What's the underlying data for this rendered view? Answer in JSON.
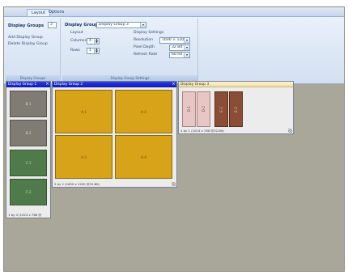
{
  "ribbon_tabs": [
    "Layout",
    "Options"
  ],
  "display_groups": {
    "label": "Display Groups",
    "count": "3",
    "add_label": "Add Display Group",
    "delete_label": "Delete Display Group",
    "caption": "Display Groups"
  },
  "group_settings": {
    "display_group_label": "Display Group",
    "display_group_value": "Display Group 3",
    "layout_label": "Layout",
    "columns_label": "Columns",
    "columns_value": "4",
    "rows_label": "Rows",
    "rows_value": "1",
    "display_settings_label": "Display Settings",
    "resolution_label": "Resolution",
    "resolution_value": "1600 × 1200",
    "pixel_depth_label": "Pixel Depth",
    "pixel_depth_value": "32 Bit",
    "refresh_rate_label": "Refresh Rate",
    "refresh_rate_value": "60 Hz",
    "caption": "Display Group Settings"
  },
  "panels": [
    {
      "title": "Display Group 1",
      "status": "1 by 4 (1024 x 768 @",
      "tiles": [
        {
          "label": "B-1",
          "color": "gray"
        },
        {
          "label": "B-2",
          "color": "gray"
        },
        {
          "label": "C-1",
          "color": "green"
        },
        {
          "label": "C-2",
          "color": "green"
        }
      ]
    },
    {
      "title": "Display Group 2",
      "status": "2 by 2 (1600 x 1200 @32-Bit)",
      "tiles": [
        {
          "label": "A-1",
          "color": "gold"
        },
        {
          "label": "A-2",
          "color": "gold"
        },
        {
          "label": "A-3",
          "color": "gold"
        },
        {
          "label": "A-4",
          "color": "gold"
        }
      ]
    },
    {
      "title": "Display Group 3",
      "status": "4 by 1 (1024 x 768 @32-Bit)",
      "tiles": [
        {
          "label": "D-1",
          "color": "pink"
        },
        {
          "label": "D-2",
          "color": "pink"
        },
        {
          "label": "E-1",
          "color": "brown"
        },
        {
          "label": "E-2",
          "color": "brown"
        }
      ]
    }
  ]
}
